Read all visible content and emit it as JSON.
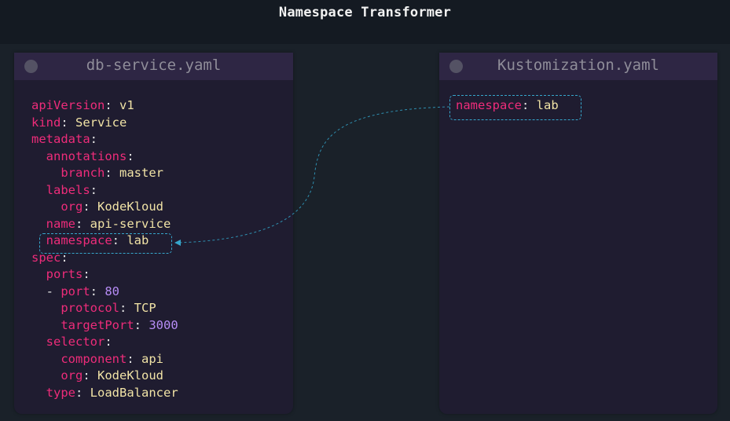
{
  "title": "Namespace Transformer",
  "left_card": {
    "title": "db-service.yaml",
    "lines": [
      {
        "indent": "",
        "key": "apiVersion",
        "sep": ": ",
        "value": "v1",
        "type": "str"
      },
      {
        "indent": "",
        "key": "kind",
        "sep": ": ",
        "value": "Service",
        "type": "str"
      },
      {
        "indent": "",
        "key": "metadata",
        "sep": ":",
        "value": "",
        "type": "str"
      },
      {
        "indent": "  ",
        "key": "annotations",
        "sep": ":",
        "value": "",
        "type": "str"
      },
      {
        "indent": "    ",
        "key": "branch",
        "sep": ": ",
        "value": "master",
        "type": "str"
      },
      {
        "indent": "  ",
        "key": "labels",
        "sep": ":",
        "value": "",
        "type": "str"
      },
      {
        "indent": "    ",
        "key": "org",
        "sep": ": ",
        "value": "KodeKloud",
        "type": "str"
      },
      {
        "indent": "  ",
        "key": "name",
        "sep": ": ",
        "value": "api-service",
        "type": "str"
      },
      {
        "indent": "  ",
        "key": "namespace",
        "sep": ": ",
        "value": "lab",
        "type": "str"
      },
      {
        "indent": "",
        "key": "spec",
        "sep": ":",
        "value": "",
        "type": "str"
      },
      {
        "indent": "  ",
        "key": "ports",
        "sep": ":",
        "value": "",
        "type": "str"
      },
      {
        "indent": "  - ",
        "key": "port",
        "sep": ": ",
        "value": "80",
        "type": "num"
      },
      {
        "indent": "    ",
        "key": "protocol",
        "sep": ": ",
        "value": "TCP",
        "type": "str"
      },
      {
        "indent": "    ",
        "key": "targetPort",
        "sep": ": ",
        "value": "3000",
        "type": "num"
      },
      {
        "indent": "  ",
        "key": "selector",
        "sep": ":",
        "value": "",
        "type": "str"
      },
      {
        "indent": "    ",
        "key": "component",
        "sep": ": ",
        "value": "api",
        "type": "str"
      },
      {
        "indent": "    ",
        "key": "org",
        "sep": ": ",
        "value": "KodeKloud",
        "type": "str"
      },
      {
        "indent": "  ",
        "key": "type",
        "sep": ": ",
        "value": "LoadBalancer",
        "type": "str"
      }
    ]
  },
  "right_card": {
    "title": "Kustomization.yaml",
    "lines": [
      {
        "indent": "",
        "key": "namespace",
        "sep": ": ",
        "value": "lab",
        "type": "str"
      }
    ]
  },
  "colors": {
    "key": "#ee2c7a",
    "string": "#f1e3a6",
    "number": "#b68cf5",
    "highlight": "#36a6cc"
  }
}
